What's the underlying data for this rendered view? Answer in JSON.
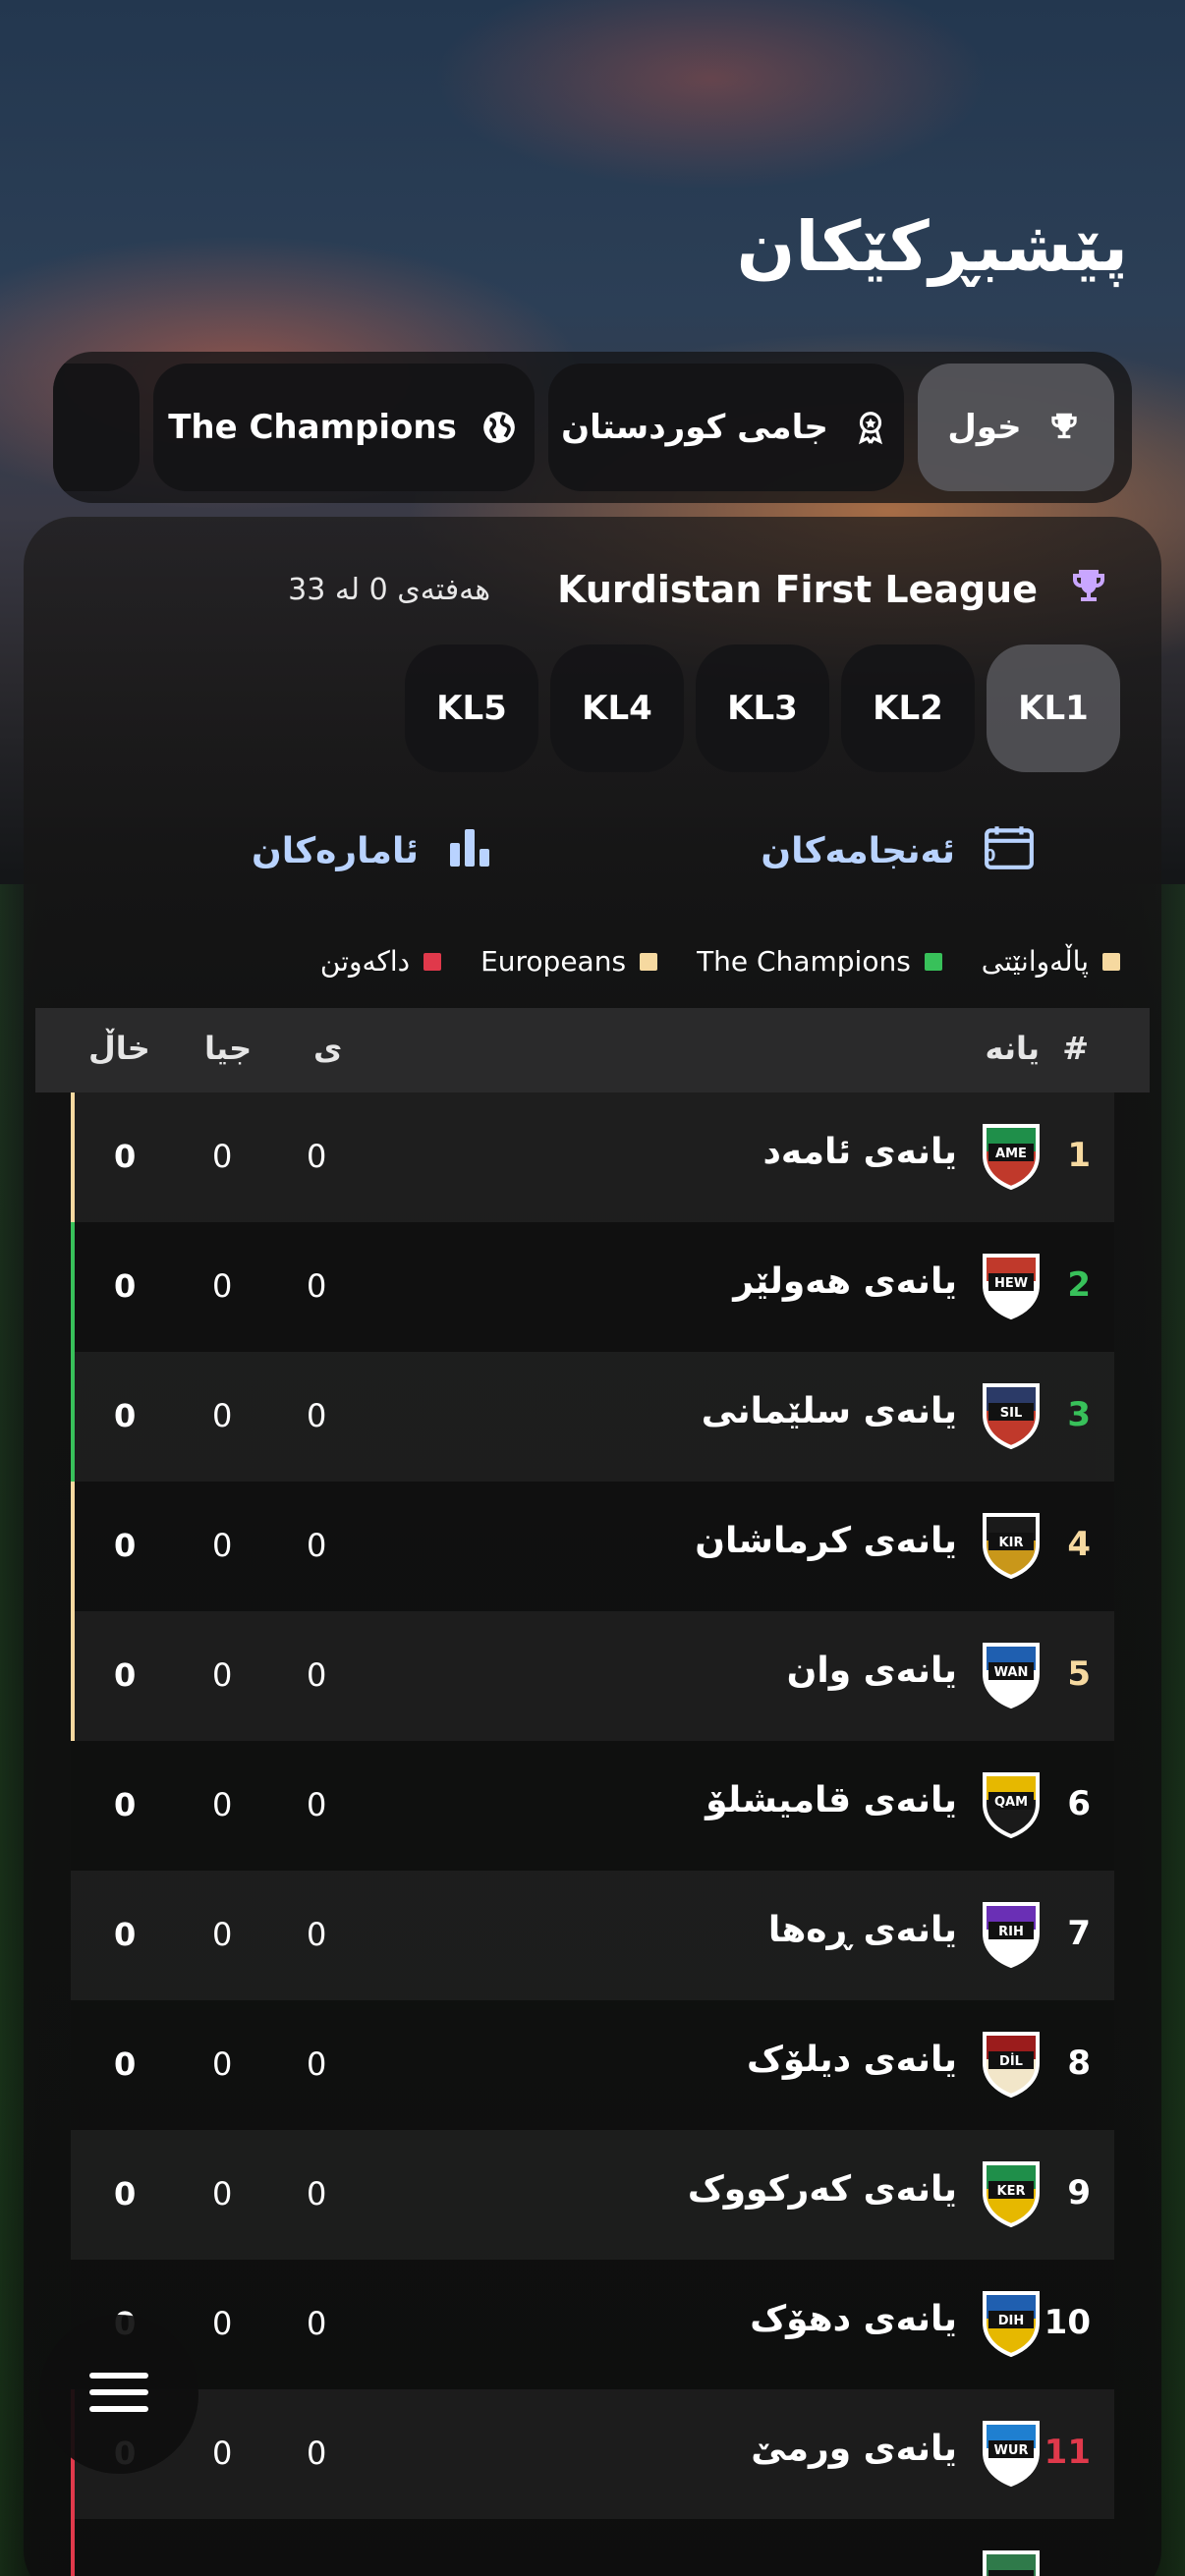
{
  "page": {
    "title": "پێشبڕکێکان"
  },
  "categories": [
    {
      "label": "خول",
      "icon": "trophy-icon",
      "active": true
    },
    {
      "label": "جامی کوردستان",
      "icon": "medal-icon",
      "active": false
    },
    {
      "label": "The Champions",
      "icon": "globe-icon",
      "active": false
    },
    {
      "label": "",
      "icon": "globe-icon",
      "active": false
    }
  ],
  "league": {
    "name": "Kurdistan First League",
    "week_text": "هەفتەی 0 لە 33",
    "icon": "trophy-icon",
    "icon_color": "#c9a6ff"
  },
  "divisions": [
    {
      "label": "KL1",
      "active": true
    },
    {
      "label": "KL2",
      "active": false
    },
    {
      "label": "KL3",
      "active": false
    },
    {
      "label": "KL4",
      "active": false
    },
    {
      "label": "KL5",
      "active": false
    }
  ],
  "links": {
    "results": {
      "label": "ئەنجامەکان",
      "icon": "scoreboard-icon"
    },
    "stats": {
      "label": "ئامارەکان",
      "icon": "bar-chart-icon"
    }
  },
  "legend": [
    {
      "label": "پاڵەوانێتی",
      "color": "#f6d9a0"
    },
    {
      "label": "The Champions",
      "color": "#38c15a"
    },
    {
      "label": "Europeans",
      "color": "#f6d9a0"
    },
    {
      "label": "داکەوتن",
      "color": "#e0394b"
    }
  ],
  "table": {
    "headers": {
      "rank": "#",
      "team": "یانە",
      "played": "ی",
      "goal_diff": "جیا",
      "points": "خاڵ"
    },
    "rows": [
      {
        "rank": "1",
        "name": "یانەی ئامەد",
        "code": "AME",
        "played": "0",
        "diff": "0",
        "points": "0",
        "zone_color": "#f6d9a0",
        "rank_color": "#f6d9a0",
        "crest_top": "#1f8f4a",
        "crest_bottom": "#c0392b"
      },
      {
        "rank": "2",
        "name": "یانەی هەولێر",
        "code": "HEW",
        "played": "0",
        "diff": "0",
        "points": "0",
        "zone_color": "#38c15a",
        "rank_color": "#38c15a",
        "crest_top": "#c0392b",
        "crest_bottom": "#ffffff"
      },
      {
        "rank": "3",
        "name": "یانەی سلێمانی",
        "code": "SIL",
        "played": "0",
        "diff": "0",
        "points": "0",
        "zone_color": "#38c15a",
        "rank_color": "#38c15a",
        "crest_top": "#2b3a67",
        "crest_bottom": "#c0392b"
      },
      {
        "rank": "4",
        "name": "یانەی کرماشان",
        "code": "KIR",
        "played": "0",
        "diff": "0",
        "points": "0",
        "zone_color": "#f6d9a0",
        "rank_color": "#f6d9a0",
        "crest_top": "#1a1a1a",
        "crest_bottom": "#c9971a"
      },
      {
        "rank": "5",
        "name": "یانەی وان",
        "code": "WAN",
        "played": "0",
        "diff": "0",
        "points": "0",
        "zone_color": "#f6d9a0",
        "rank_color": "#f6d9a0",
        "crest_top": "#1f5fb0",
        "crest_bottom": "#ffffff"
      },
      {
        "rank": "6",
        "name": "یانەی قامیشلۆ",
        "code": "QAM",
        "played": "0",
        "diff": "0",
        "points": "0",
        "zone_color": "",
        "rank_color": "#ffffff",
        "crest_top": "#e6b800",
        "crest_bottom": "#1a1a1a"
      },
      {
        "rank": "7",
        "name": "یانەی ڕەها",
        "code": "RIH",
        "played": "0",
        "diff": "0",
        "points": "0",
        "zone_color": "",
        "rank_color": "#ffffff",
        "crest_top": "#6a2fb5",
        "crest_bottom": "#ffffff"
      },
      {
        "rank": "8",
        "name": "یانەی دیلۆک",
        "code": "DİL",
        "played": "0",
        "diff": "0",
        "points": "0",
        "zone_color": "",
        "rank_color": "#ffffff",
        "crest_top": "#9b1c1c",
        "crest_bottom": "#f2e6c9"
      },
      {
        "rank": "9",
        "name": "یانەی کەرکووک",
        "code": "KER",
        "played": "0",
        "diff": "0",
        "points": "0",
        "zone_color": "",
        "rank_color": "#ffffff",
        "crest_top": "#1f8f4a",
        "crest_bottom": "#e6b800"
      },
      {
        "rank": "10",
        "name": "یانەی دهۆک",
        "code": "DIH",
        "played": "0",
        "diff": "0",
        "points": "0",
        "zone_color": "",
        "rank_color": "#ffffff",
        "crest_top": "#1f5fb0",
        "crest_bottom": "#e6b800"
      },
      {
        "rank": "11",
        "name": "یانەی ورمێ",
        "code": "WUR",
        "played": "0",
        "diff": "0",
        "points": "0",
        "zone_color": "#e0394b",
        "rank_color": "#e0394b",
        "crest_top": "#1f7fd0",
        "crest_bottom": "#ffffff"
      },
      {
        "rank": "",
        "name": "",
        "code": "",
        "played": "",
        "diff": "",
        "points": "",
        "zone_color": "#e0394b",
        "rank_color": "#e0394b",
        "crest_top": "#2f7a4a",
        "crest_bottom": "#ffffff"
      }
    ]
  },
  "fab": {
    "icon": "hamburger-menu-icon"
  }
}
